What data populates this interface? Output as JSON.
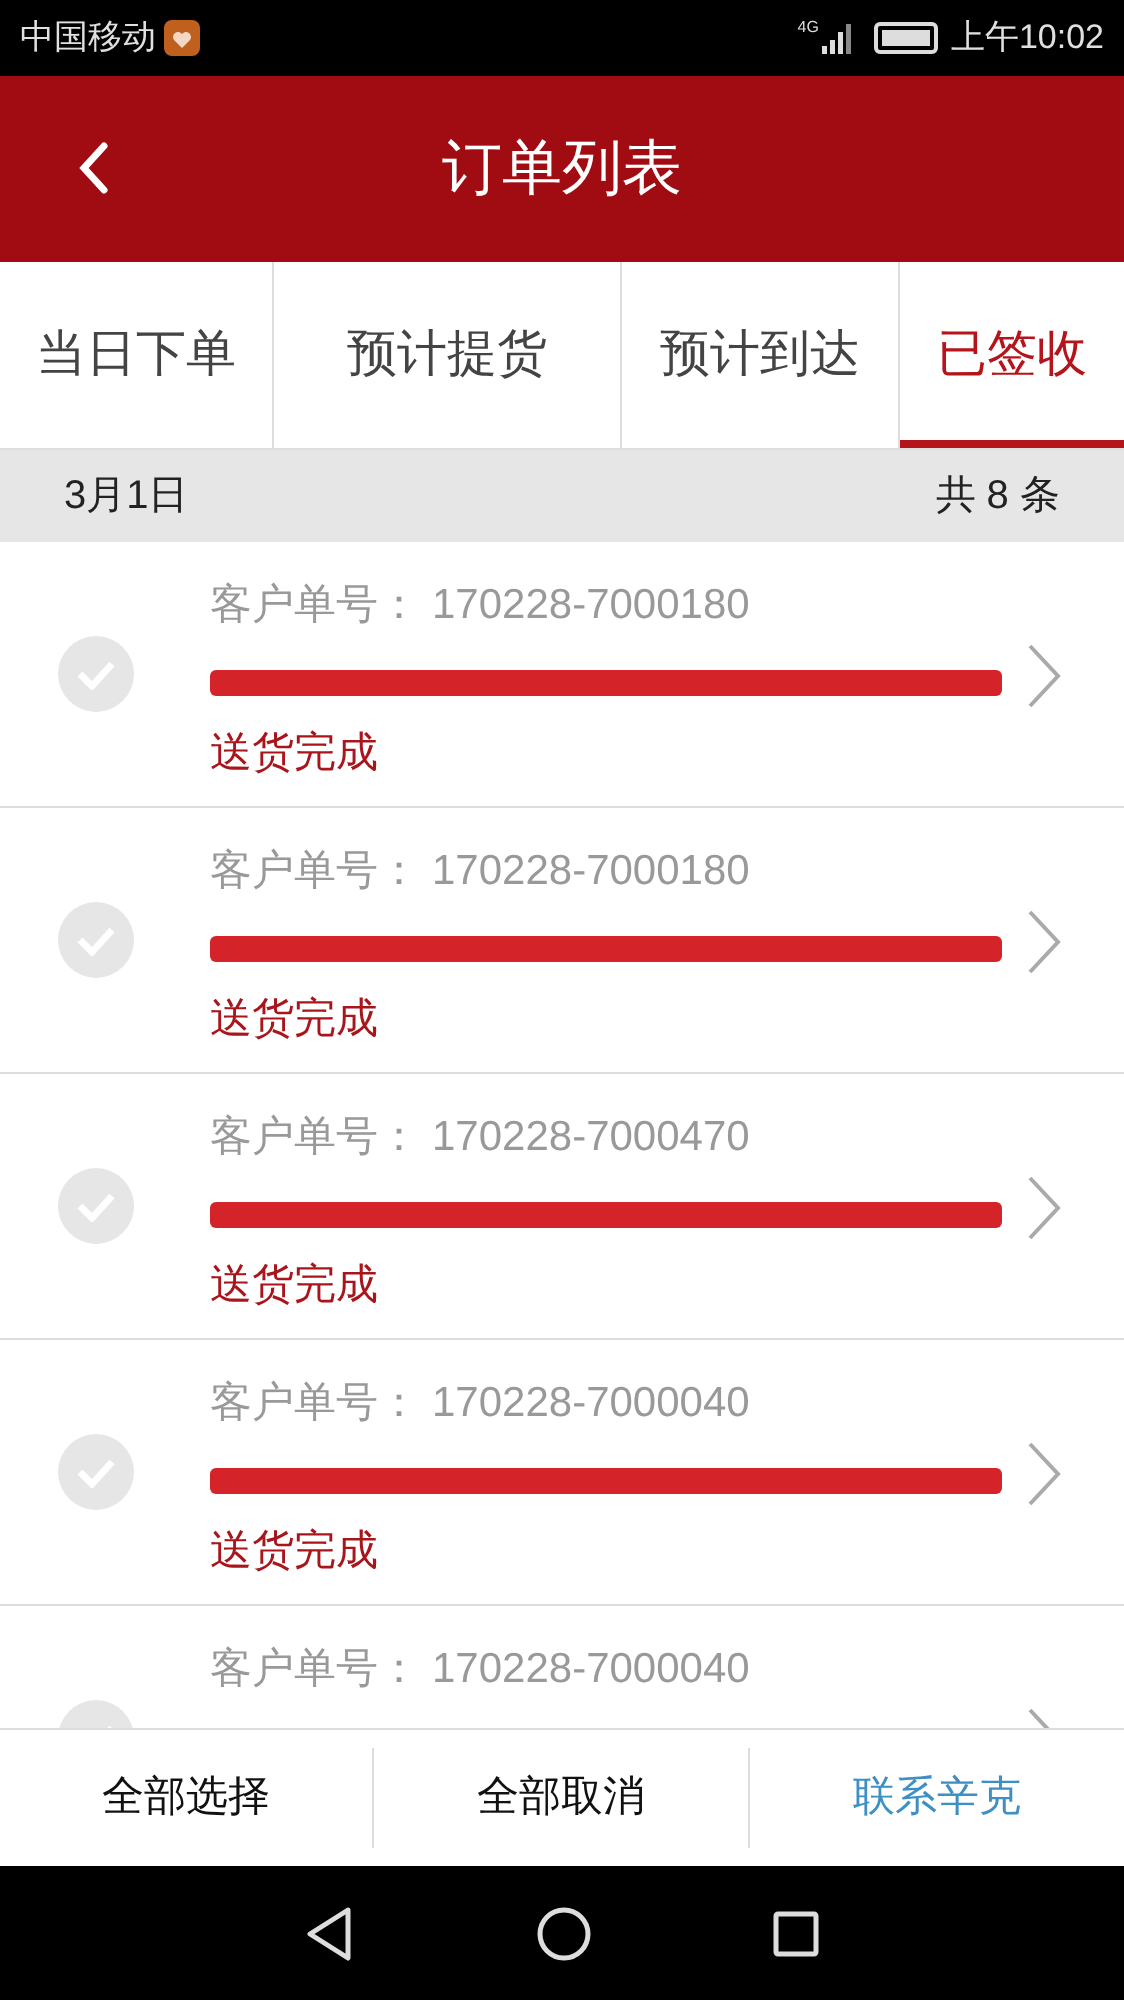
{
  "status_bar": {
    "carrier": "中国移动",
    "network": "4G",
    "time": "上午10:02"
  },
  "header": {
    "title": "订单列表"
  },
  "tabs": [
    {
      "label": "当日下单",
      "selected": false
    },
    {
      "label": "预计提货",
      "selected": false
    },
    {
      "label": "预计到达",
      "selected": false
    },
    {
      "label": "已签收",
      "selected": true
    }
  ],
  "date_bar": {
    "date": "3月1日",
    "count": "共 8 条"
  },
  "orders": [
    {
      "label": "客户单号：",
      "number": "170228-7000180",
      "checked": false,
      "level": 1,
      "status": "送货完成"
    },
    {
      "label": "客户单号：",
      "number": "170228-7000180",
      "checked": false,
      "level": 1,
      "status": "送货完成"
    },
    {
      "label": "客户单号：",
      "number": "170228-7000470",
      "checked": false,
      "level": 1,
      "status": "送货完成"
    },
    {
      "label": "客户单号：",
      "number": "170228-7000040",
      "checked": false,
      "level": 1,
      "status": "送货完成"
    },
    {
      "label": "客户单号：",
      "number": "170228-7000040",
      "checked": false
    }
  ],
  "actions": [
    {
      "label": "全部选择",
      "kind": "plain"
    },
    {
      "label": "全部取消",
      "kind": "plain"
    },
    {
      "label": "联系辛克",
      "kind": "link"
    }
  ]
}
